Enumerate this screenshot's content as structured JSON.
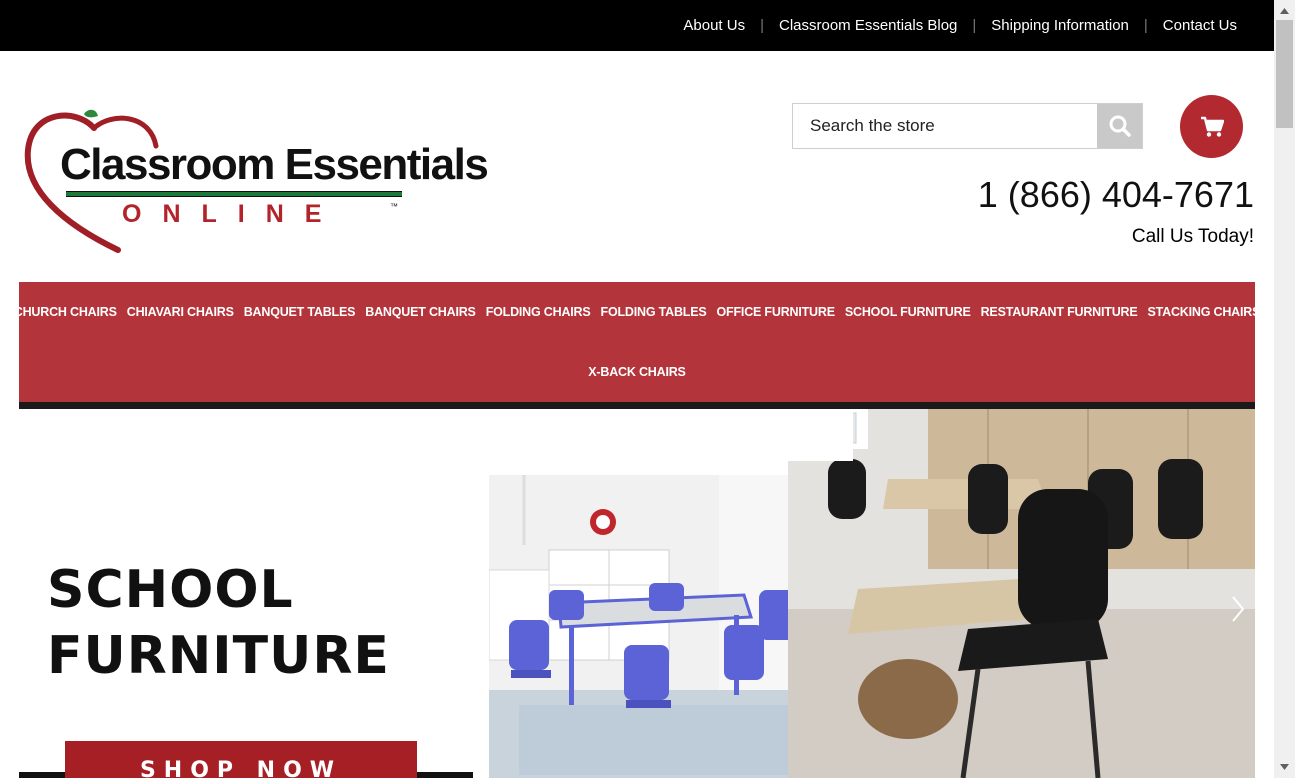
{
  "top_links": [
    "About Us",
    "Classroom Essentials Blog",
    "Shipping Information",
    "Contact Us"
  ],
  "logo": {
    "line1": "Classroom Essentials",
    "line2": "ONLINE",
    "tm": "™"
  },
  "search": {
    "placeholder": "Search the store"
  },
  "phone": "1 (866) 404-7671",
  "call_today": "Call Us Today!",
  "nav": {
    "row1": [
      "CHURCH CHAIRS",
      "CHIAVARI CHAIRS",
      "BANQUET TABLES",
      "BANQUET CHAIRS",
      "FOLDING CHAIRS",
      "FOLDING TABLES",
      "OFFICE FURNITURE",
      "SCHOOL FURNITURE",
      "RESTAURANT FURNITURE",
      "STACKING CHAIRS"
    ],
    "row2": [
      "X-BACK CHAIRS"
    ]
  },
  "banner": {
    "title_line1": "SCHOOL",
    "title_line2": "FURNITURE",
    "cta": "SHOP NOW"
  },
  "colors": {
    "brand_red": "#b3353b",
    "cart_red": "#b22a30",
    "chair_blue": "#5b63d6",
    "green": "#1e7a3a"
  },
  "icons": {
    "search": "search-icon",
    "cart": "cart-icon",
    "next": "chevron-right-icon"
  }
}
